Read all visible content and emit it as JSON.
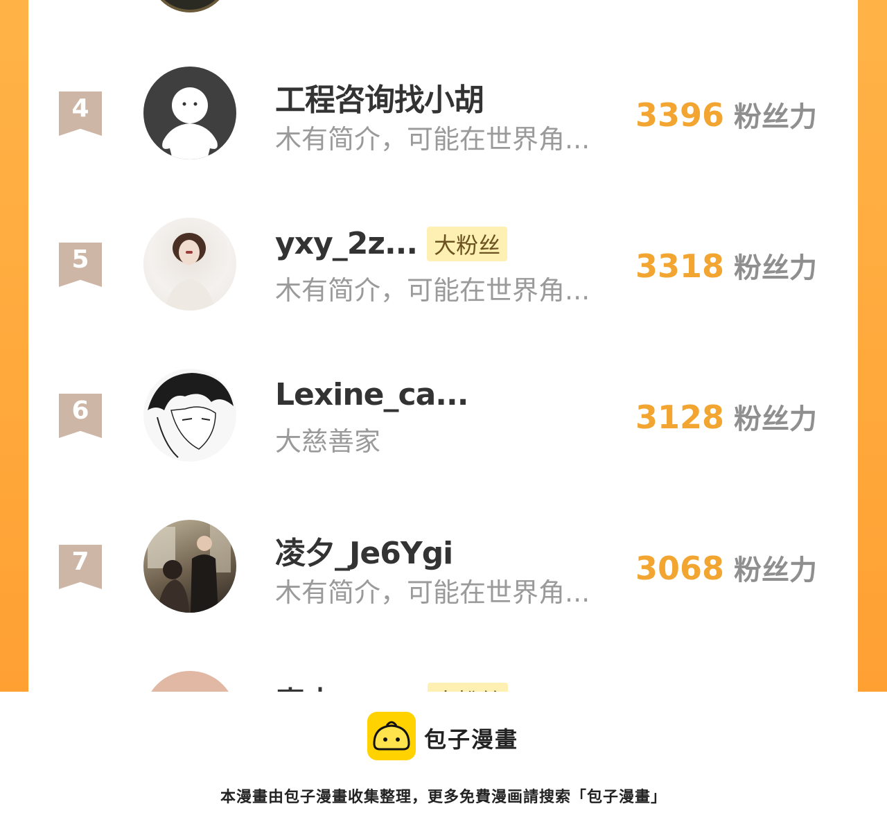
{
  "ranking": {
    "score_unit": "粉丝力",
    "rows": [
      {
        "rank": "4",
        "name": "工程咨询找小胡",
        "tag": "",
        "bio": "木有简介，可能在世界角...",
        "score": "3396"
      },
      {
        "rank": "5",
        "name": "yxy_2z...",
        "tag": "大粉丝",
        "bio": "木有简介，可能在世界角...",
        "score": "3318"
      },
      {
        "rank": "6",
        "name": "Lexine_ca...",
        "tag": "",
        "bio": "大慈善家",
        "score": "3128"
      },
      {
        "rank": "7",
        "name": "凌夕_Je6Ygi",
        "tag": "",
        "bio": "木有简介，可能在世界角...",
        "score": "3068"
      }
    ],
    "partial_next": {
      "name": "麦本",
      "tag": "大粉丝"
    }
  },
  "footer": {
    "logo_text": "包子漫畫",
    "note": "本漫畫由包子漫畫收集整理，更多免費漫画請搜索「包子漫畫」"
  },
  "colors": {
    "frame": "#ffa033",
    "score": "#f2a530",
    "rank_badge": "#cdb6a6",
    "tag_bg": "#fdf0b2",
    "logo": "#ffd200"
  }
}
